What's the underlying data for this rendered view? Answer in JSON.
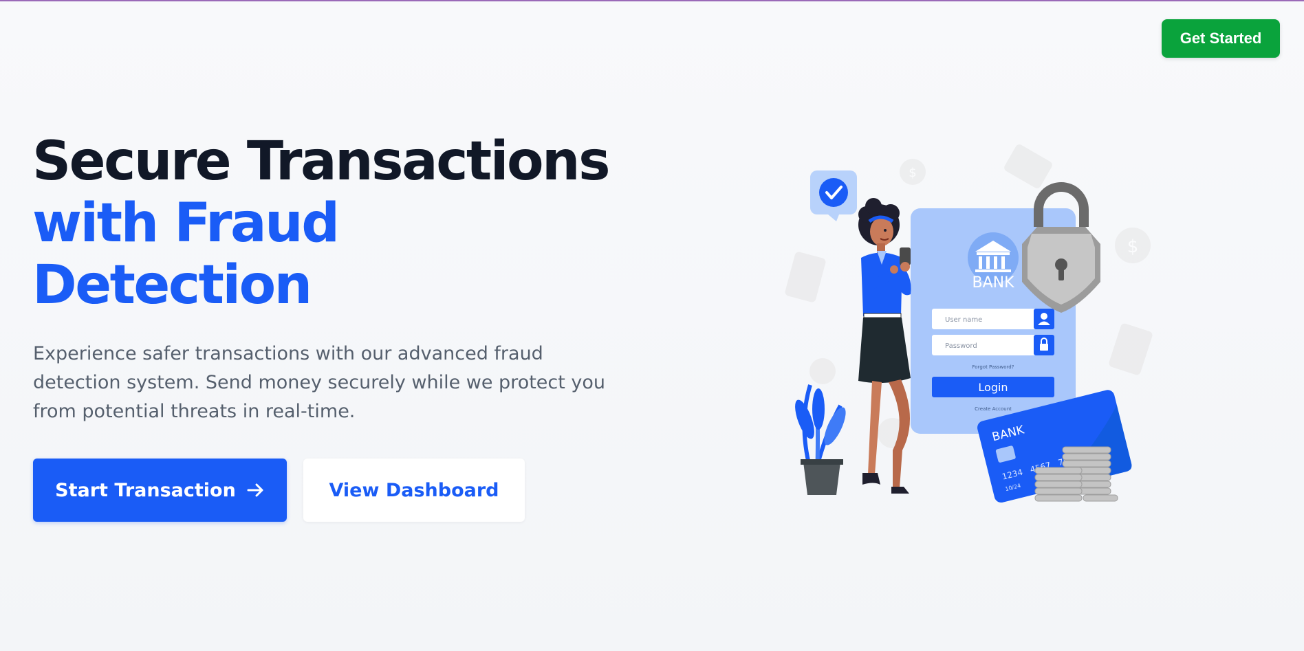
{
  "header": {
    "cta_label": "Get Started"
  },
  "hero": {
    "title_line1": "Secure Transactions",
    "title_line2": "with Fraud",
    "title_line3": "Detection",
    "subtitle": "Experience safer transactions with our advanced fraud detection system. Send money securely while we protect you from potential threats in real-time.",
    "primary_button": "Start Transaction",
    "primary_icon": "arrow-right-icon",
    "secondary_button": "View Dashboard"
  },
  "illustration": {
    "bank_label": "BANK",
    "username_placeholder": "User name",
    "password_placeholder": "Password",
    "forgot_password": "Forgot Password?",
    "login_button": "Login",
    "create_account": "Create Account",
    "card_bank_label": "BANK",
    "card_numbers": [
      "1234",
      "4567",
      "78"
    ],
    "card_expiry": "10/24"
  },
  "colors": {
    "brand_blue": "#1a5cf6",
    "brand_green": "#0aa33c",
    "title_dark": "#111827",
    "body_text": "#555f6d"
  }
}
